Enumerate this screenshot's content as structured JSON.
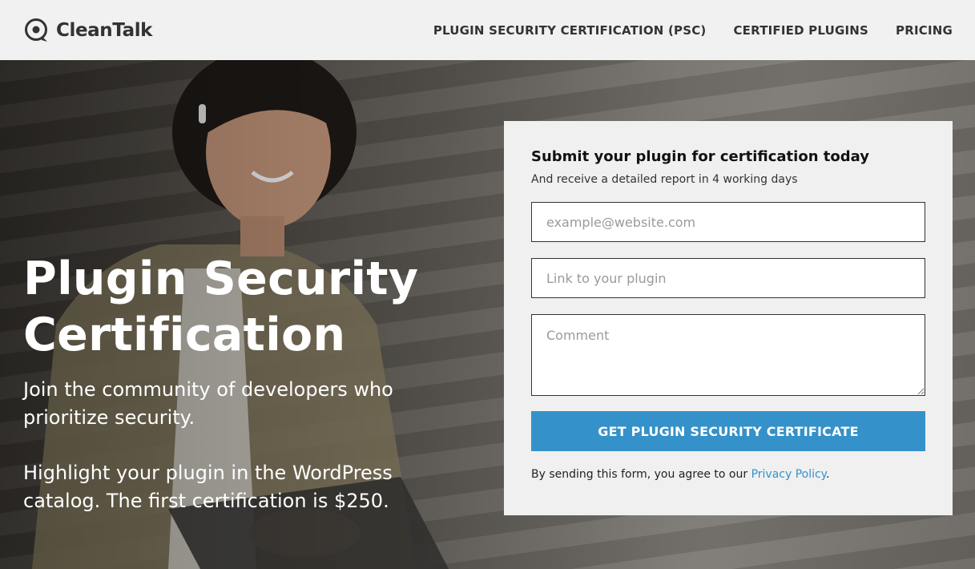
{
  "header": {
    "logo_text": "CleanTalk",
    "logo_icon": "cleantalk-logo-icon",
    "nav": [
      {
        "label": "PLUGIN SECURITY CERTIFICATION (PSC)"
      },
      {
        "label": "CERTIFIED PLUGINS"
      },
      {
        "label": "PRICING"
      }
    ]
  },
  "hero": {
    "title": "Plugin Security Certification",
    "subtitle": "Join the community of developers who prioritize security.",
    "subtitle2": "Highlight your plugin in the WordPress catalog. The first certification is $250."
  },
  "form": {
    "title": "Submit your plugin for certification today",
    "subtitle": "And receive a detailed report in 4 working days",
    "email_placeholder": "example@website.com",
    "link_placeholder": "Link to your plugin",
    "comment_placeholder": "Comment",
    "submit_label": "GET PLUGIN SECURITY CERTIFICATE",
    "consent_prefix": "By sending this form, you agree to our ",
    "consent_link": "Privacy Policy",
    "consent_suffix": "."
  },
  "colors": {
    "accent": "#3591c9",
    "header_bg": "#f1f1f1",
    "card_bg": "#f0f0f0"
  }
}
